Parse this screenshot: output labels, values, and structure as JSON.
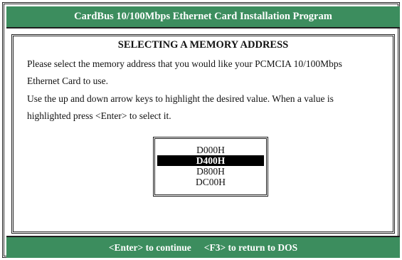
{
  "window": {
    "title": "CardBus 10/100Mbps Ethernet Card Installation Program"
  },
  "dialog": {
    "heading": "SELECTING A MEMORY ADDRESS",
    "lines": [
      "Please select the memory address  that you would like your PCMCIA 10/100Mbps",
      "Ethernet Card to use.",
      "Use the up and down arrow keys to highlight the desired value.  When a value is",
      "highlighted press <Enter> to select it."
    ]
  },
  "address_list": {
    "options": [
      "D000H",
      "D400H",
      "D800H",
      "DC00H"
    ],
    "selected": "D400H"
  },
  "footer": {
    "continue_hint": "<Enter> to continue",
    "return_hint": "<F3> to return to DOS"
  },
  "colors": {
    "bar_background": "#3c8d5e",
    "bar_text": "#ffffff",
    "selection_background": "#000000",
    "selection_text": "#ffffff"
  }
}
